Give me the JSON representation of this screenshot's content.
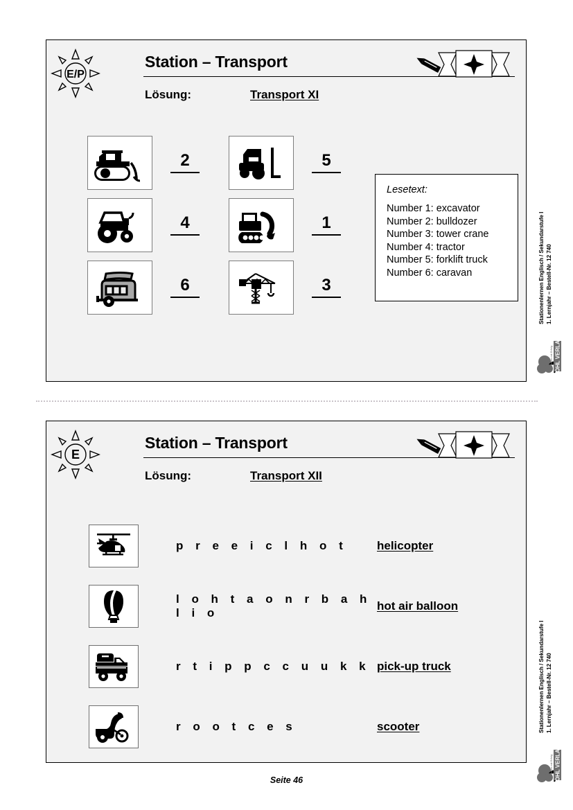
{
  "page": {
    "footer_label": "Seite 46",
    "panel_bg": "#f2f2f2",
    "accent": "#000000"
  },
  "sidebar": {
    "line1": "Stationenlernen Englisch / Sekundarstufe I",
    "line2": "1. Lernjahr  –  Bestell-Nr. 12 740",
    "publisher": "KOHL VERLAG",
    "publisher_tagline": "Lernen mit Erfolg"
  },
  "worksheets": [
    {
      "badge_letter": "E/P",
      "title": "Station – Transport",
      "loesung_label": "Lösung:",
      "loesung_value": "Transport XI",
      "pencil_icon": "pencil-icon",
      "ribbon_icon": "star-ribbon-icon",
      "items": [
        {
          "icon": "bulldozer-icon",
          "answer": "2"
        },
        {
          "icon": "forklift-truck-icon",
          "answer": "5"
        },
        {
          "icon": "tractor-icon",
          "answer": "4"
        },
        {
          "icon": "excavator-icon",
          "answer": "1"
        },
        {
          "icon": "caravan-icon",
          "answer": "6"
        },
        {
          "icon": "tower-crane-icon",
          "answer": "3"
        }
      ],
      "lesetext": {
        "title": "Lesetext:",
        "lines": [
          "Number 1: excavator",
          "Number 2: bulldozer",
          "Number 3: tower crane",
          "Number 4: tractor",
          "Number 5: forklift truck",
          "Number 6: caravan"
        ]
      }
    },
    {
      "badge_letter": "E",
      "title": "Station – Transport",
      "loesung_label": "Lösung:",
      "loesung_value": "Transport XII",
      "pencil_icon": "pencil-icon",
      "ribbon_icon": "star-ribbon-icon",
      "rows": [
        {
          "icon": "helicopter-icon",
          "scrambled": "p r e e i c l h o t",
          "solution": "helicopter"
        },
        {
          "icon": "hot-air-balloon-icon",
          "scrambled": "l o h t a o n r b a h l i o",
          "solution": "hot air balloon"
        },
        {
          "icon": "pickup-truck-icon",
          "scrambled": "r t i p p c c u u k k",
          "solution": "pick-up truck"
        },
        {
          "icon": "scooter-icon",
          "scrambled": "r o o t c e s",
          "solution": "scooter"
        }
      ]
    }
  ]
}
